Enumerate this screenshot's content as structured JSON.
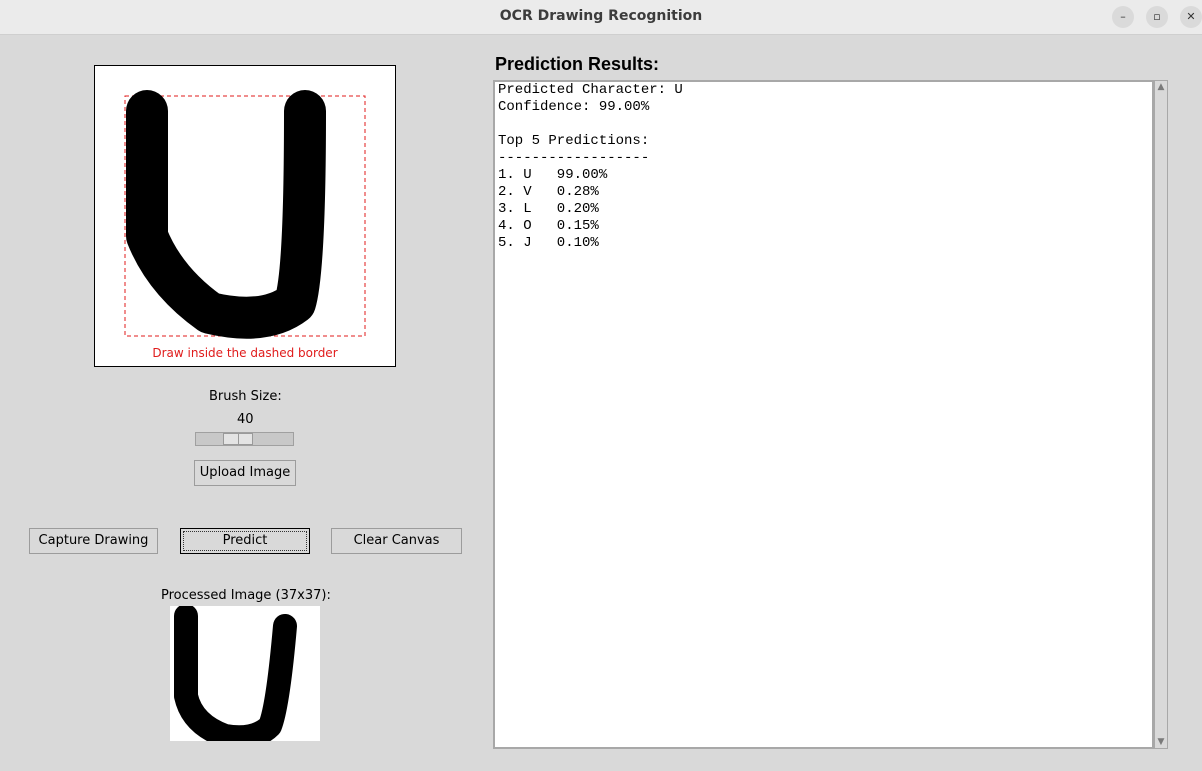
{
  "window": {
    "title": "OCR Drawing Recognition",
    "minimize_glyph": "–",
    "maximize_glyph": "▫",
    "close_glyph": "✕"
  },
  "canvas": {
    "hint": "Draw inside the dashed border"
  },
  "brush": {
    "label": "Brush Size:",
    "value": "40",
    "level_fraction": 0.4
  },
  "buttons": {
    "upload": "Upload Image",
    "capture": "Capture Drawing",
    "predict": "Predict",
    "clear": "Clear Canvas"
  },
  "processed": {
    "label": "Processed Image (37x37):"
  },
  "results": {
    "title": "Prediction Results:",
    "lines": [
      "Predicted Character: U",
      "Confidence: 99.00%",
      "",
      "Top 5 Predictions:",
      "------------------",
      "1. U   99.00%",
      "2. V   0.28%",
      "3. L   0.20%",
      "4. O   0.15%",
      "5. J   0.10%"
    ]
  },
  "scrollbar": {
    "up_glyph": "▲",
    "down_glyph": "▼"
  }
}
